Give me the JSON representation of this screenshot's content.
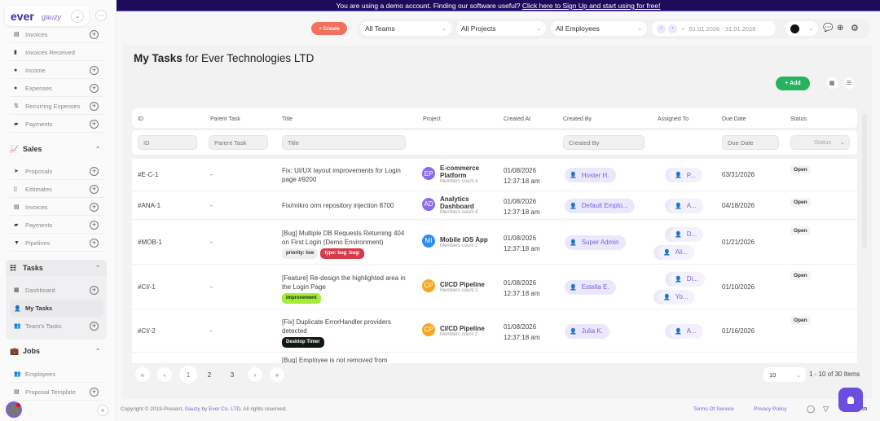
{
  "banner": {
    "text": "You are using a demo account. Finding our software useful? ",
    "link": "Click here to Sign Up and start using for free!"
  },
  "logo": {
    "brand": "ever",
    "sub": "gauzy"
  },
  "sidebar": {
    "items_top": [
      {
        "label": "Invoices",
        "icon": "invoice-icon",
        "plus": true
      },
      {
        "label": "Invoices Received",
        "icon": "invoice-received-icon",
        "plus": false
      },
      {
        "label": "Income",
        "icon": "income-icon",
        "plus": true
      },
      {
        "label": "Expenses",
        "icon": "expenses-icon",
        "plus": true
      },
      {
        "label": "Recurring Expenses",
        "icon": "recurring-icon",
        "plus": true
      },
      {
        "label": "Payments",
        "icon": "payments-icon",
        "plus": true
      }
    ],
    "sales": {
      "label": "Sales",
      "items": [
        {
          "label": "Proposals",
          "icon": "proposals-icon",
          "plus": true
        },
        {
          "label": "Estimates",
          "icon": "estimates-icon",
          "plus": true
        },
        {
          "label": "Invoices",
          "icon": "invoice-icon",
          "plus": true
        },
        {
          "label": "Payments",
          "icon": "payments-icon",
          "plus": true
        },
        {
          "label": "Pipelines",
          "icon": "pipelines-icon",
          "plus": true
        }
      ]
    },
    "tasks": {
      "label": "Tasks",
      "items": [
        {
          "label": "Dashboard",
          "icon": "dashboard-icon",
          "plus": true
        },
        {
          "label": "My Tasks",
          "icon": "user-icon",
          "plus": false,
          "active": true
        },
        {
          "label": "Team's Tasks",
          "icon": "team-icon",
          "plus": true
        }
      ]
    },
    "jobs": {
      "label": "Jobs",
      "items": [
        {
          "label": "Employees",
          "icon": "team-icon",
          "plus": false
        },
        {
          "label": "Proposal Template",
          "icon": "template-icon",
          "plus": true
        }
      ]
    }
  },
  "header": {
    "create": "+ Create",
    "teams": "All Teams",
    "projects": "All Projects",
    "employees": "All Employees",
    "date_range": "01.01.2026 - 31.01.2026"
  },
  "page": {
    "title_bold": "My Tasks",
    "title_rest": " for Ever Technologies LTD",
    "add": "+ Add"
  },
  "table": {
    "columns": [
      "ID",
      "Parent Task",
      "Title",
      "Project",
      "Created At",
      "Created By",
      "Assigned To",
      "Due Date",
      "Status"
    ],
    "filters": {
      "id": "ID",
      "parent": "Parent Task",
      "title": "Title",
      "created_by": "Created By",
      "due": "Due Date",
      "status": "Status"
    },
    "rows": [
      {
        "id": "#E-C-1",
        "parent": "-",
        "title": "Fix: UI/UX layout improvements for Login page #9200",
        "tags": [],
        "proj_init": "EP",
        "proj_color": "#8b6cf0",
        "project": "E-commerce Platform",
        "members": "Members count 4",
        "created": "01/08/2026",
        "time": "12:37:18 am",
        "created_by": "Hoster H.",
        "assigned": [
          "P..."
        ],
        "due": "03/31/2026",
        "status": "Open"
      },
      {
        "id": "#ANA-1",
        "parent": "-",
        "title": "Fix/mikro orm repository injection 8700",
        "tags": [],
        "proj_init": "AD",
        "proj_color": "#8b6cf0",
        "project": "Analytics Dashboard",
        "members": "Members count 4",
        "created": "01/08/2026",
        "time": "12:37:18 am",
        "created_by": "Default Emplo...",
        "assigned": [
          "A..."
        ],
        "due": "04/18/2026",
        "status": "Open"
      },
      {
        "id": "#MOB-1",
        "parent": "-",
        "title": "[Bug] Multiple DB Requests Returning 404 on First Login (Demo Environment)",
        "tags": [
          {
            "label": "priority: low",
            "bg": "#eeeeee",
            "fg": "#333"
          },
          {
            "label": "type: bug :bug:",
            "bg": "#d73a4a",
            "fg": "#fff"
          }
        ],
        "proj_init": "MI",
        "proj_color": "#2d8cf0",
        "project": "Mobile iOS App",
        "members": "Members count 2",
        "created": "01/08/2026",
        "time": "12:37:18 am",
        "created_by": "Super Admin",
        "assigned": [
          "D...",
          "Ali..."
        ],
        "due": "01/21/2026",
        "status": "Open"
      },
      {
        "id": "#CI/-1",
        "parent": "-",
        "title": "[Feature] Re-design the highlighted area in the Login Page",
        "tags": [
          {
            "label": "improvement",
            "bg": "#a2ee37",
            "fg": "#222"
          }
        ],
        "proj_init": "CP",
        "proj_color": "#f5a623",
        "project": "CI/CD Pipeline",
        "members": "Members count 2",
        "created": "01/08/2026",
        "time": "12:37:18 am",
        "created_by": "Estella E.",
        "assigned": [
          "Di...",
          "Yo..."
        ],
        "due": "01/10/2026",
        "status": "Open"
      },
      {
        "id": "#CI/-2",
        "parent": "-",
        "title": "[Fix] Duplicate ErrorHandler providers detected",
        "tags": [
          {
            "label": "Desktop Timer",
            "bg": "#111a12",
            "fg": "#fff"
          }
        ],
        "proj_init": "CP",
        "proj_color": "#f5a623",
        "project": "CI/CD Pipeline",
        "members": "Members count 2",
        "created": "01/08/2026",
        "time": "12:37:18 am",
        "created_by": "Julia K.",
        "assigned": [
          "A..."
        ],
        "due": "01/16/2026",
        "status": "Open"
      }
    ],
    "partial_title": "[Bug] Employee is not removed from"
  },
  "pagination": {
    "first": "«",
    "prev": "‹",
    "pages": [
      "1",
      "2",
      "3"
    ],
    "current": "1",
    "next": "›",
    "last": "»",
    "page_size": "10",
    "summary": "1 - 10 of 30 Items"
  },
  "footer": {
    "pre": "Copyright © 2019-Present, ",
    "gauzy": "Gauzy",
    "by": " by ",
    "ever": "Ever Co. LTD.",
    "post": " All rights reserved.",
    "terms": "Terms Of Service",
    "privacy": "Privacy Policy"
  },
  "colors": {
    "accent": "#7b5ce6",
    "banner": "#1e0c5a",
    "add": "#25b35f",
    "create": "#f2705e"
  }
}
